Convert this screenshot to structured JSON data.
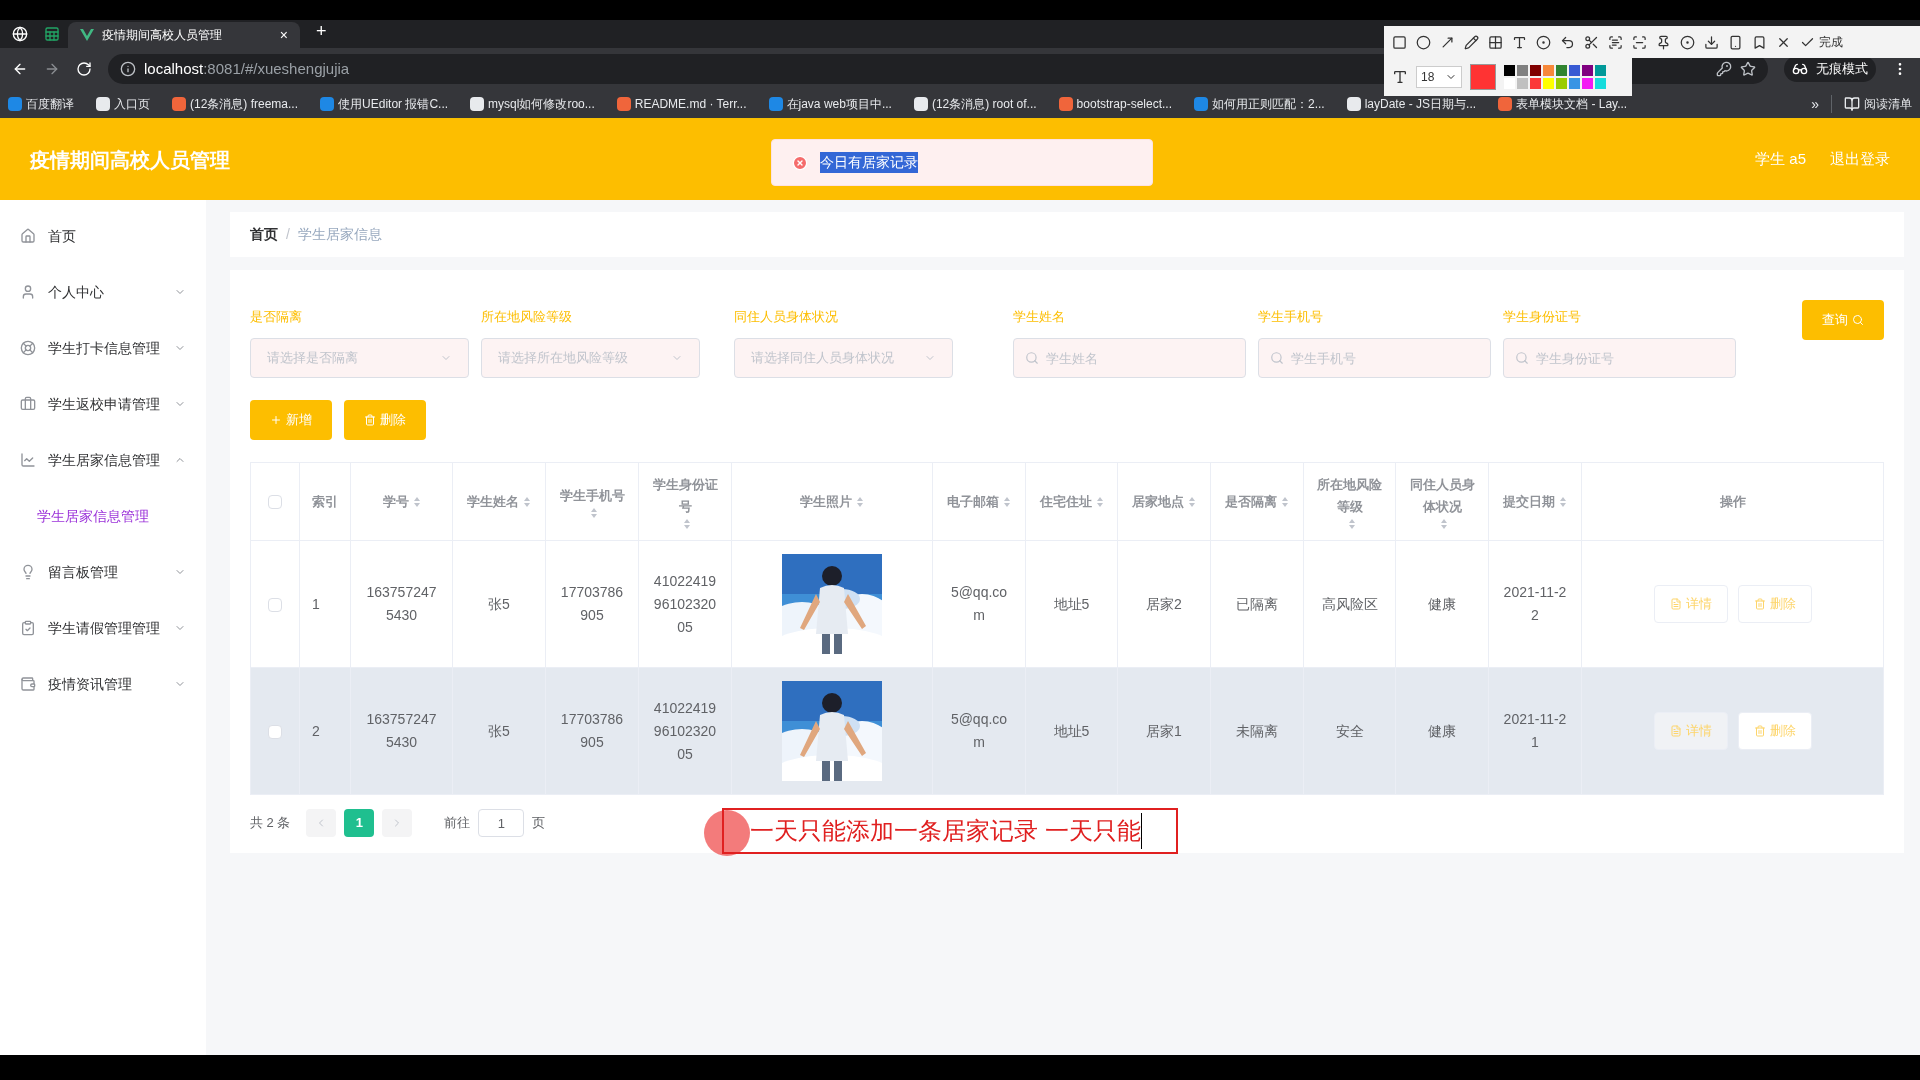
{
  "browser": {
    "tabs": [
      {
        "label": "疫情期间高校人员管理",
        "selected": true
      }
    ],
    "close": "×",
    "new_tab": "+",
    "address": {
      "host": "localhost",
      "path": ":8081/#/xueshengjujia"
    },
    "incognito": "无痕模式",
    "bookmarks": [
      "百度翻译",
      "入口页",
      "(12条消息) freema...",
      "使用UEditor 报错C...",
      "mysql如何修改roo...",
      "README.md · Terr...",
      "在java web项目中...",
      "(12条消息) root of...",
      "bootstrap-select...",
      "如何用正则匹配：2...",
      "layDate - JS日期与...",
      "表单模块文档 - Lay..."
    ],
    "more": "»",
    "reading_list": "阅读清单"
  },
  "capture_toolbar": {
    "done": "完成",
    "font_size": "18",
    "palette": [
      {
        "color": "#000000"
      },
      {
        "color": "#808080"
      },
      {
        "color": "#800000"
      },
      {
        "color": "#f7883a"
      },
      {
        "color": "#308430"
      },
      {
        "color": "#385ad3"
      },
      {
        "color": "#800080"
      },
      {
        "color": "#009999"
      },
      {
        "color": "#ffffff"
      },
      {
        "color": "#c0c0c0"
      },
      {
        "color": "#fb3838"
      },
      {
        "color": "#ffff00"
      },
      {
        "color": "#99cc00"
      },
      {
        "color": "#3894e4"
      },
      {
        "color": "#f31bf3"
      },
      {
        "color": "#16dcdc"
      }
    ]
  },
  "header": {
    "title": "疫情期间高校人员管理",
    "user": "学生 a5",
    "logout": "退出登录"
  },
  "toast": {
    "message": "今日有居家记录",
    "highlighted": true
  },
  "sidebar": {
    "items": [
      {
        "label": "首页"
      },
      {
        "label": "个人中心",
        "expanded": false
      },
      {
        "label": "学生打卡信息管理",
        "expanded": false
      },
      {
        "label": "学生返校申请管理",
        "expanded": false
      },
      {
        "label": "学生居家信息管理",
        "expanded": true,
        "children": [
          {
            "label": "学生居家信息管理",
            "selected": true
          }
        ]
      },
      {
        "label": "留言板管理",
        "expanded": false
      },
      {
        "label": "学生请假管理管理",
        "expanded": false
      },
      {
        "label": "疫情资讯管理",
        "expanded": false
      }
    ]
  },
  "breadcrumb": [
    "首页",
    "学生居家信息"
  ],
  "breadcrumb_separator": "/",
  "filters": [
    {
      "kind": "select",
      "label": "是否隔离",
      "placeholder": "请选择是否隔离"
    },
    {
      "kind": "select",
      "label": "所在地风险等级",
      "placeholder": "请选择所在地风险等级"
    },
    {
      "kind": "select",
      "label": "同住人员身体状况",
      "placeholder": "请选择同住人员身体状况"
    },
    {
      "kind": "input",
      "label": "学生姓名",
      "placeholder": "学生姓名"
    },
    {
      "kind": "input",
      "label": "学生手机号",
      "placeholder": "学生手机号"
    },
    {
      "kind": "input",
      "label": "学生身份证号",
      "placeholder": "学生身份证号"
    }
  ],
  "search_button": "查询",
  "add_button": "新增",
  "delete_button": "删除",
  "table": {
    "header_checked": false,
    "columns": [
      {
        "label": "索引",
        "sortable": false
      },
      {
        "label": "学号",
        "sortable": true
      },
      {
        "label": "学生姓名",
        "sortable": true
      },
      {
        "label": "学生手机号",
        "sortable": true
      },
      {
        "label": "学生身份证号",
        "sortable": true
      },
      {
        "label": "学生照片",
        "sortable": true
      },
      {
        "label": "电子邮箱",
        "sortable": true
      },
      {
        "label": "住宅住址",
        "sortable": true
      },
      {
        "label": "居家地点",
        "sortable": true
      },
      {
        "label": "是否隔离",
        "sortable": true
      },
      {
        "label": "所在地风险等级",
        "sortable": true
      },
      {
        "label": "同住人员身体状况",
        "sortable": true
      },
      {
        "label": "提交日期",
        "sortable": true
      },
      {
        "label": "操作",
        "sortable": false
      }
    ],
    "rows": [
      {
        "checked": false,
        "hovered": false,
        "cells": [
          "1",
          "1637572475430",
          "张5",
          "17703786905",
          "410224199610232005",
          {
            "kind": "picture"
          },
          "5@qq.com",
          "地址5",
          "居家2",
          "已隔离",
          "高风险区",
          "健康",
          "2021-11-22"
        ],
        "actions": [
          "详情",
          "删除"
        ]
      },
      {
        "checked": false,
        "hovered": true,
        "cells": [
          "2",
          "1637572475430",
          "张5",
          "17703786905",
          "410224199610232005",
          {
            "kind": "picture"
          },
          "5@qq.com",
          "地址5",
          "居家1",
          "未隔离",
          "安全",
          "健康",
          "2021-11-21"
        ],
        "actions": [
          "详情",
          "删除"
        ]
      }
    ]
  },
  "pagination": {
    "total": "共 2 条",
    "pages": [
      {
        "label": "1",
        "selected": true
      }
    ],
    "goto": "前往",
    "page_input": "1",
    "page_unit": "页"
  },
  "annotation": {
    "text": "一天只能添加一条居家记录 一天只能"
  }
}
